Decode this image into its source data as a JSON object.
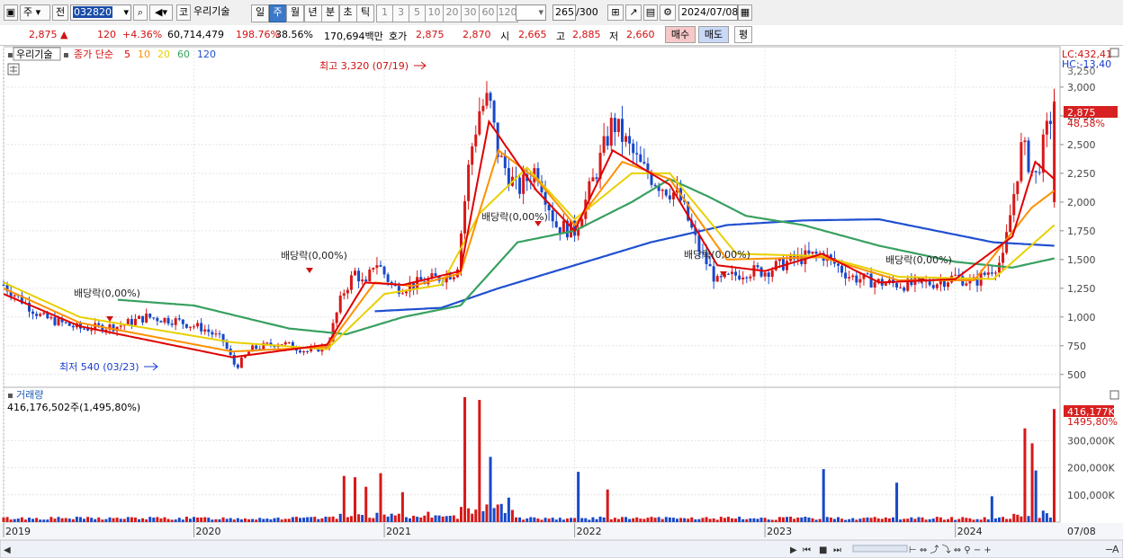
{
  "toolbar": {
    "type_label": "주",
    "prev_label": "전",
    "code_value": "032820",
    "market_label": "코",
    "stock_name": "우리기술",
    "periods": [
      {
        "label": "일",
        "selected": false
      },
      {
        "label": "주",
        "selected": true
      },
      {
        "label": "월",
        "selected": false
      },
      {
        "label": "년",
        "selected": false
      },
      {
        "label": "분",
        "selected": false
      },
      {
        "label": "초",
        "selected": false
      },
      {
        "label": "틱",
        "selected": false
      }
    ],
    "intervals": [
      "1",
      "3",
      "5",
      "10",
      "20",
      "30",
      "60",
      "120"
    ],
    "count_value": "265",
    "count_total": "/300",
    "date_value": "2024/07/08"
  },
  "info": {
    "price": "2,875",
    "arrow": "▲",
    "change": "120",
    "change_pct": "+4.36%",
    "volume": "60,714,479",
    "vol_ratio": "198.76%",
    "turnover": "38.56%",
    "amount": "170,694백만",
    "quote_label": "호가",
    "ask": "2,875",
    "bid": "2,870",
    "open_label": "시",
    "open": "2,665",
    "high_label": "고",
    "high": "2,885",
    "low_label": "저",
    "low": "2,660",
    "buy_label": "매수",
    "sell_label": "매도",
    "eval_label": "평"
  },
  "price_panel": {
    "legend_name": "우리기술",
    "legend_ma": "종가 단순",
    "ma_periods": [
      {
        "label": "5",
        "color": "#e00000"
      },
      {
        "label": "10",
        "color": "#ff9000"
      },
      {
        "label": "20",
        "color": "#e8d000"
      },
      {
        "label": "60",
        "color": "#38a060"
      },
      {
        "label": "120",
        "color": "#2050d0"
      }
    ],
    "lc_label": "LC:432,41",
    "hc_label": "HC:-13,40",
    "price_tag": "2,875",
    "pct_tag": "48,58%",
    "top_tick_partial": "3,250",
    "y_ticks": [
      "3,000",
      "2,750",
      "2,500",
      "2,250",
      "2,000",
      "1,750",
      "1,500",
      "1,250",
      "1,000",
      "750",
      "500"
    ],
    "high_label": "최고 3,320 (07/19)",
    "low_label": "최저 540 (03/23)",
    "dividend_labels": [
      "배당락(0,00%)",
      "배당락(0,00%)",
      "배당락(0,00%)",
      "배당락(0,00%)",
      "배당락(0,00%)"
    ]
  },
  "volume_panel": {
    "title": "거래량",
    "value_label": "416,176,502주(1,495,80%)",
    "vol_tag": "416,177K",
    "pct_tag": "1495,80%",
    "y_ticks": [
      "300,000K",
      "200,000K",
      "100,000K"
    ]
  },
  "x_axis": {
    "labels": [
      "2019",
      "2020",
      "2021",
      "2022",
      "2023",
      "2024"
    ],
    "right_label": "07/08"
  },
  "chart_data": {
    "type": "candlestick",
    "period": "weekly",
    "x_range": [
      "2019-01",
      "2024-07-08"
    ],
    "price_ylim": [
      420,
      3320
    ],
    "volume_unit": "K shares",
    "volume_ylim": [
      0,
      450000
    ],
    "price_close_approx": [
      [
        2019.0,
        1280
      ],
      [
        2019.2,
        1000
      ],
      [
        2019.4,
        900
      ],
      [
        2019.6,
        920
      ],
      [
        2019.75,
        1000
      ],
      [
        2019.9,
        970
      ],
      [
        2020.05,
        900
      ],
      [
        2020.15,
        800
      ],
      [
        2020.22,
        560
      ],
      [
        2020.3,
        720
      ],
      [
        2020.45,
        780
      ],
      [
        2020.6,
        700
      ],
      [
        2020.7,
        750
      ],
      [
        2020.78,
        1200
      ],
      [
        2020.85,
        1400
      ],
      [
        2020.9,
        1250
      ],
      [
        2020.95,
        1500
      ],
      [
        2021.05,
        1250
      ],
      [
        2021.15,
        1280
      ],
      [
        2021.3,
        1350
      ],
      [
        2021.38,
        1400
      ],
      [
        2021.45,
        2400
      ],
      [
        2021.5,
        2800
      ],
      [
        2021.55,
        2900
      ],
      [
        2021.6,
        2400
      ],
      [
        2021.7,
        2100
      ],
      [
        2021.8,
        2300
      ],
      [
        2021.9,
        1800
      ],
      [
        2022.0,
        1750
      ],
      [
        2022.1,
        2200
      ],
      [
        2022.2,
        2700
      ],
      [
        2022.35,
        2300
      ],
      [
        2022.45,
        2150
      ],
      [
        2022.55,
        2050
      ],
      [
        2022.65,
        1600
      ],
      [
        2022.75,
        1300
      ],
      [
        2022.9,
        1400
      ],
      [
        2023.0,
        1400
      ],
      [
        2023.15,
        1500
      ],
      [
        2023.3,
        1550
      ],
      [
        2023.45,
        1350
      ],
      [
        2023.6,
        1300
      ],
      [
        2023.75,
        1280
      ],
      [
        2023.9,
        1300
      ],
      [
        2024.0,
        1350
      ],
      [
        2024.1,
        1300
      ],
      [
        2024.25,
        1500
      ],
      [
        2024.35,
        2500
      ],
      [
        2024.42,
        2200
      ],
      [
        2024.52,
        2875
      ]
    ],
    "ma5_approx": [
      [
        2019.0,
        1200
      ],
      [
        2019.4,
        920
      ],
      [
        2020.2,
        650
      ],
      [
        2020.7,
        760
      ],
      [
        2020.9,
        1300
      ],
      [
        2021.1,
        1280
      ],
      [
        2021.4,
        1400
      ],
      [
        2021.55,
        2700
      ],
      [
        2021.8,
        2100
      ],
      [
        2022.0,
        1750
      ],
      [
        2022.2,
        2450
      ],
      [
        2022.5,
        2150
      ],
      [
        2022.75,
        1450
      ],
      [
        2023.0,
        1400
      ],
      [
        2023.3,
        1550
      ],
      [
        2023.6,
        1300
      ],
      [
        2024.0,
        1330
      ],
      [
        2024.3,
        1700
      ],
      [
        2024.42,
        2350
      ],
      [
        2024.52,
        2200
      ]
    ],
    "ma10_approx": [
      [
        2019.0,
        1250
      ],
      [
        2019.4,
        950
      ],
      [
        2020.2,
        700
      ],
      [
        2020.7,
        740
      ],
      [
        2020.95,
        1300
      ],
      [
        2021.15,
        1270
      ],
      [
        2021.4,
        1380
      ],
      [
        2021.6,
        2450
      ],
      [
        2021.8,
        2200
      ],
      [
        2022.0,
        1800
      ],
      [
        2022.25,
        2350
      ],
      [
        2022.5,
        2200
      ],
      [
        2022.8,
        1500
      ],
      [
        2023.3,
        1520
      ],
      [
        2023.7,
        1320
      ],
      [
        2024.1,
        1320
      ],
      [
        2024.4,
        1950
      ],
      [
        2024.52,
        2100
      ]
    ],
    "ma20_approx": [
      [
        2019.0,
        1300
      ],
      [
        2019.4,
        1000
      ],
      [
        2020.2,
        780
      ],
      [
        2020.7,
        720
      ],
      [
        2021.0,
        1200
      ],
      [
        2021.3,
        1280
      ],
      [
        2021.5,
        1900
      ],
      [
        2021.75,
        2300
      ],
      [
        2022.0,
        1850
      ],
      [
        2022.3,
        2250
      ],
      [
        2022.5,
        2250
      ],
      [
        2022.85,
        1550
      ],
      [
        2023.3,
        1530
      ],
      [
        2023.7,
        1350
      ],
      [
        2024.2,
        1330
      ],
      [
        2024.52,
        1800
      ]
    ],
    "ma60_approx": [
      [
        2019.6,
        1150
      ],
      [
        2020.0,
        1100
      ],
      [
        2020.5,
        900
      ],
      [
        2020.8,
        850
      ],
      [
        2021.1,
        1000
      ],
      [
        2021.4,
        1100
      ],
      [
        2021.7,
        1650
      ],
      [
        2022.0,
        1750
      ],
      [
        2022.3,
        2000
      ],
      [
        2022.5,
        2200
      ],
      [
        2022.7,
        2050
      ],
      [
        2022.9,
        1880
      ],
      [
        2023.2,
        1800
      ],
      [
        2023.6,
        1620
      ],
      [
        2024.0,
        1480
      ],
      [
        2024.3,
        1430
      ],
      [
        2024.52,
        1510
      ]
    ],
    "ma120_approx": [
      [
        2020.95,
        1050
      ],
      [
        2021.3,
        1080
      ],
      [
        2021.6,
        1250
      ],
      [
        2022.0,
        1450
      ],
      [
        2022.4,
        1650
      ],
      [
        2022.8,
        1800
      ],
      [
        2023.2,
        1840
      ],
      [
        2023.6,
        1850
      ],
      [
        2023.9,
        1750
      ],
      [
        2024.2,
        1650
      ],
      [
        2024.52,
        1620
      ]
    ],
    "volume_spikes_approx": [
      [
        2020.78,
        170000
      ],
      [
        2020.85,
        165000
      ],
      [
        2020.9,
        130000
      ],
      [
        2020.98,
        180000
      ],
      [
        2021.1,
        110000
      ],
      [
        2021.42,
        460000
      ],
      [
        2021.5,
        450000
      ],
      [
        2021.55,
        240000
      ],
      [
        2021.65,
        90000
      ],
      [
        2022.02,
        185000
      ],
      [
        2022.18,
        120000
      ],
      [
        2023.3,
        195000
      ],
      [
        2023.7,
        145000
      ],
      [
        2024.2,
        95000
      ],
      [
        2024.37,
        345000
      ],
      [
        2024.4,
        290000
      ],
      [
        2024.42,
        190000
      ],
      [
        2024.52,
        416177
      ]
    ]
  }
}
